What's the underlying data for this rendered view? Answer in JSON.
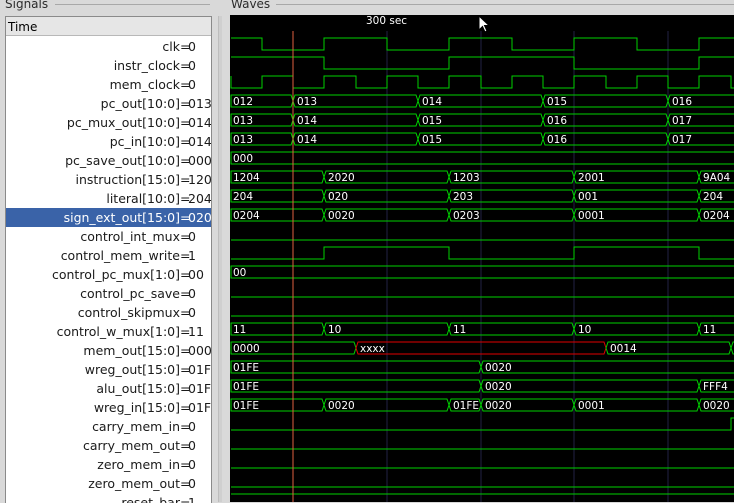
{
  "panels": {
    "signals_title": "Signals",
    "waves_title": "Waves"
  },
  "time_header": "Time",
  "marker_time_label": "300 sec",
  "selected_signal": "sign_ext_out[15:0]",
  "colors": {
    "wave": "#00d000",
    "undefined": "#e00000",
    "selection": "#3a63a8",
    "marker": "#e06040",
    "grid": "#222244"
  },
  "signals": [
    {
      "name": "clk",
      "value": "0"
    },
    {
      "name": "instr_clock",
      "value": "0"
    },
    {
      "name": "mem_clock",
      "value": "0"
    },
    {
      "name": "pc_out[10:0]",
      "value": "013"
    },
    {
      "name": "pc_mux_out[10:0]",
      "value": "014"
    },
    {
      "name": "pc_in[10:0]",
      "value": "014"
    },
    {
      "name": "pc_save_out[10:0]",
      "value": "000"
    },
    {
      "name": "instruction[15:0]",
      "value": "1204"
    },
    {
      "name": "literal[10:0]",
      "value": "204"
    },
    {
      "name": "sign_ext_out[15:0]",
      "value": "0204"
    },
    {
      "name": "control_int_mux",
      "value": "0"
    },
    {
      "name": "control_mem_write",
      "value": "1"
    },
    {
      "name": "control_pc_mux[1:0]",
      "value": "00"
    },
    {
      "name": "control_pc_save",
      "value": "0"
    },
    {
      "name": "control_skipmux",
      "value": "0"
    },
    {
      "name": "control_w_mux[1:0]",
      "value": "11"
    },
    {
      "name": "mem_out[15:0]",
      "value": "0000"
    },
    {
      "name": "wreg_out[15:0]",
      "value": "01FE"
    },
    {
      "name": "alu_out[15:0]",
      "value": "01FE"
    },
    {
      "name": "wreg_in[15:0]",
      "value": "01FE"
    },
    {
      "name": "carry_mem_in",
      "value": "0"
    },
    {
      "name": "carry_mem_out",
      "value": "0"
    },
    {
      "name": "zero_mem_in",
      "value": "0"
    },
    {
      "name": "zero_mem_out",
      "value": "0"
    },
    {
      "name": "reset_bar",
      "value": "1"
    }
  ],
  "waves": [
    {
      "kind": "bit",
      "init": 1,
      "edges": [
        31,
        93,
        156,
        218,
        281,
        343,
        406,
        468
      ]
    },
    {
      "kind": "bit",
      "init": 1,
      "edges": [
        93,
        218,
        343,
        468
      ]
    },
    {
      "kind": "bit",
      "init": 1,
      "edges": [
        0,
        31,
        62,
        93,
        125,
        156,
        187,
        218,
        250,
        281,
        312,
        343,
        375,
        406,
        437,
        468,
        500
      ]
    },
    {
      "kind": "bus",
      "segs": [
        [
          0,
          "012"
        ],
        [
          62,
          "013"
        ],
        [
          187,
          "014"
        ],
        [
          312,
          "015"
        ],
        [
          437,
          "016"
        ]
      ]
    },
    {
      "kind": "bus",
      "segs": [
        [
          0,
          "013"
        ],
        [
          62,
          "014"
        ],
        [
          187,
          "015"
        ],
        [
          312,
          "016"
        ],
        [
          437,
          "017"
        ]
      ]
    },
    {
      "kind": "bus",
      "segs": [
        [
          0,
          "013"
        ],
        [
          62,
          "014"
        ],
        [
          187,
          "015"
        ],
        [
          312,
          "016"
        ],
        [
          437,
          "017"
        ]
      ]
    },
    {
      "kind": "bus",
      "segs": [
        [
          0,
          "000"
        ]
      ]
    },
    {
      "kind": "bus",
      "segs": [
        [
          0,
          "1204"
        ],
        [
          93,
          "2020"
        ],
        [
          218,
          "1203"
        ],
        [
          343,
          "2001"
        ],
        [
          468,
          "9A04"
        ]
      ]
    },
    {
      "kind": "bus",
      "segs": [
        [
          0,
          "204"
        ],
        [
          93,
          "020"
        ],
        [
          218,
          "203"
        ],
        [
          343,
          "001"
        ],
        [
          468,
          "204"
        ]
      ]
    },
    {
      "kind": "bus",
      "segs": [
        [
          0,
          "0204"
        ],
        [
          93,
          "0020"
        ],
        [
          218,
          "0203"
        ],
        [
          343,
          "0001"
        ],
        [
          468,
          "0204"
        ]
      ]
    },
    {
      "kind": "bit",
      "init": 0,
      "edges": []
    },
    {
      "kind": "bit",
      "init": 0,
      "edges": [
        93,
        218,
        343,
        468
      ]
    },
    {
      "kind": "bus",
      "segs": [
        [
          0,
          "00"
        ]
      ]
    },
    {
      "kind": "bit",
      "init": 0,
      "edges": []
    },
    {
      "kind": "bit",
      "init": 0,
      "edges": []
    },
    {
      "kind": "bus",
      "segs": [
        [
          0,
          "11"
        ],
        [
          93,
          "10"
        ],
        [
          218,
          "11"
        ],
        [
          343,
          "10"
        ],
        [
          468,
          "11"
        ]
      ]
    },
    {
      "kind": "bus",
      "segs": [
        [
          0,
          "0000"
        ],
        [
          125,
          "xxxx",
          "x"
        ],
        [
          375,
          "0014"
        ],
        [
          500,
          ""
        ]
      ]
    },
    {
      "kind": "bus",
      "segs": [
        [
          0,
          "01FE"
        ],
        [
          250,
          "0020"
        ]
      ]
    },
    {
      "kind": "bus",
      "segs": [
        [
          0,
          "01FE"
        ],
        [
          250,
          "0020"
        ],
        [
          468,
          "FFF4"
        ]
      ]
    },
    {
      "kind": "bus",
      "segs": [
        [
          0,
          "01FE"
        ],
        [
          93,
          "0020"
        ],
        [
          218,
          "01FE"
        ],
        [
          250,
          "0020"
        ],
        [
          343,
          "0001"
        ],
        [
          468,
          "0020"
        ]
      ]
    },
    {
      "kind": "bit",
      "init": 0,
      "edges": [
        500
      ]
    },
    {
      "kind": "bit",
      "init": 0,
      "edges": []
    },
    {
      "kind": "bit",
      "init": 0,
      "edges": []
    },
    {
      "kind": "bit",
      "init": 0,
      "edges": []
    },
    {
      "kind": "bit",
      "init": 1,
      "edges": []
    }
  ]
}
